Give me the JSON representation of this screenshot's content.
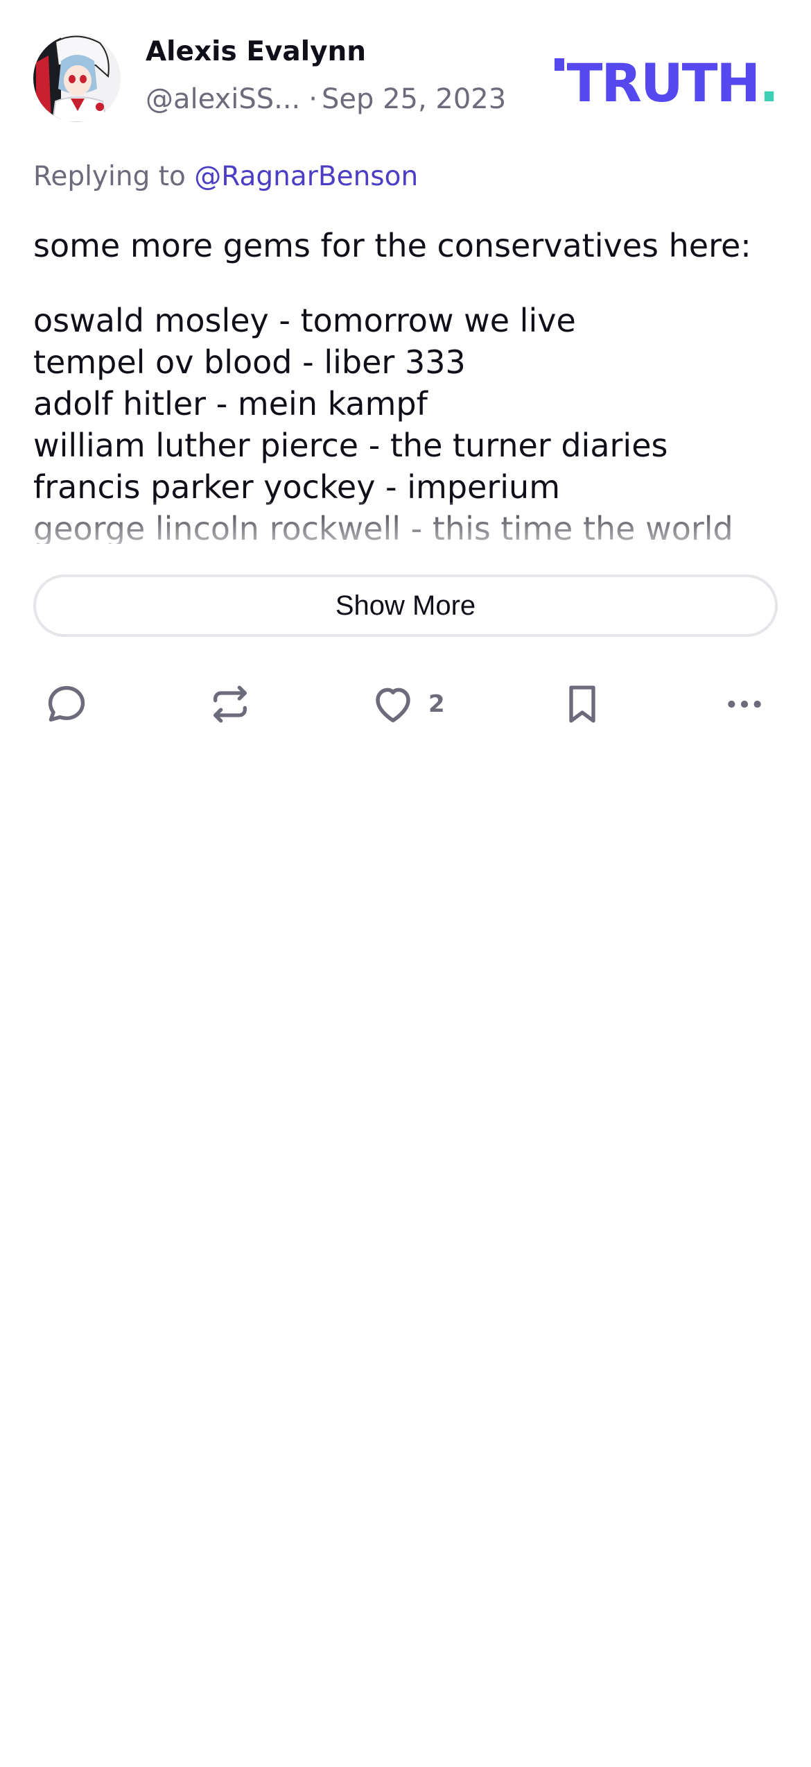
{
  "post": {
    "author": {
      "display_name": "Alexis Evalynn",
      "handle": "@alexiSS...",
      "avatar_icon": "anime-avatar"
    },
    "separator": "·",
    "date": "Sep 25, 2023",
    "brand": {
      "logo_text": "TRUTH",
      "logo_dot": ".",
      "primary_color": "#5448ee",
      "accent_color": "#3ed0b4"
    },
    "reply": {
      "prefix": "Replying to",
      "handle": "@RagnarBenson"
    },
    "content": {
      "intro": "some more gems for the conservatives here:",
      "lines": [
        "oswald mosley - tomorrow we live",
        "tempel ov blood - liber 333",
        "adolf hitler - mein kampf",
        "william luther pierce - the turner diaries",
        "francis parker yockey - imperium",
        "george lincoln rockwell - this time the world"
      ]
    },
    "show_more_label": "Show More",
    "actions": {
      "reply_icon": "comment-icon",
      "repost_icon": "repost-icon",
      "like_icon": "heart-icon",
      "like_count": "2",
      "bookmark_icon": "bookmark-icon",
      "more_icon": "more-icon"
    }
  }
}
